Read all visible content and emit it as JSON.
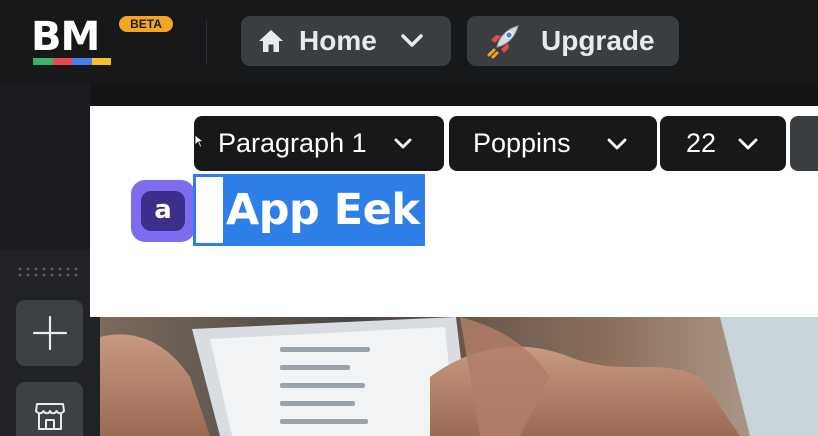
{
  "app": {
    "logo_text": "BM",
    "badge": "BETA",
    "logo_colors": [
      "#3db36a",
      "#e5484d",
      "#4a7ef0",
      "#f5c02e"
    ]
  },
  "nav": {
    "home_label": "Home",
    "home_icon": "home-icon",
    "upgrade_label": "Upgrade",
    "upgrade_icon": "rocket-icon"
  },
  "text_toolbar": {
    "paragraph_style": "Paragraph 1",
    "font_family": "Poppins",
    "font_size": "22"
  },
  "canvas": {
    "app_icon_letter": "a",
    "selected_text": "App Eek!"
  },
  "tools": {
    "add_icon": "plus-icon",
    "store_icon": "storefront-icon"
  },
  "colors": {
    "accent": "#f5a524",
    "selection": "#2f7fe8",
    "app_icon": "#7c6cf0"
  }
}
